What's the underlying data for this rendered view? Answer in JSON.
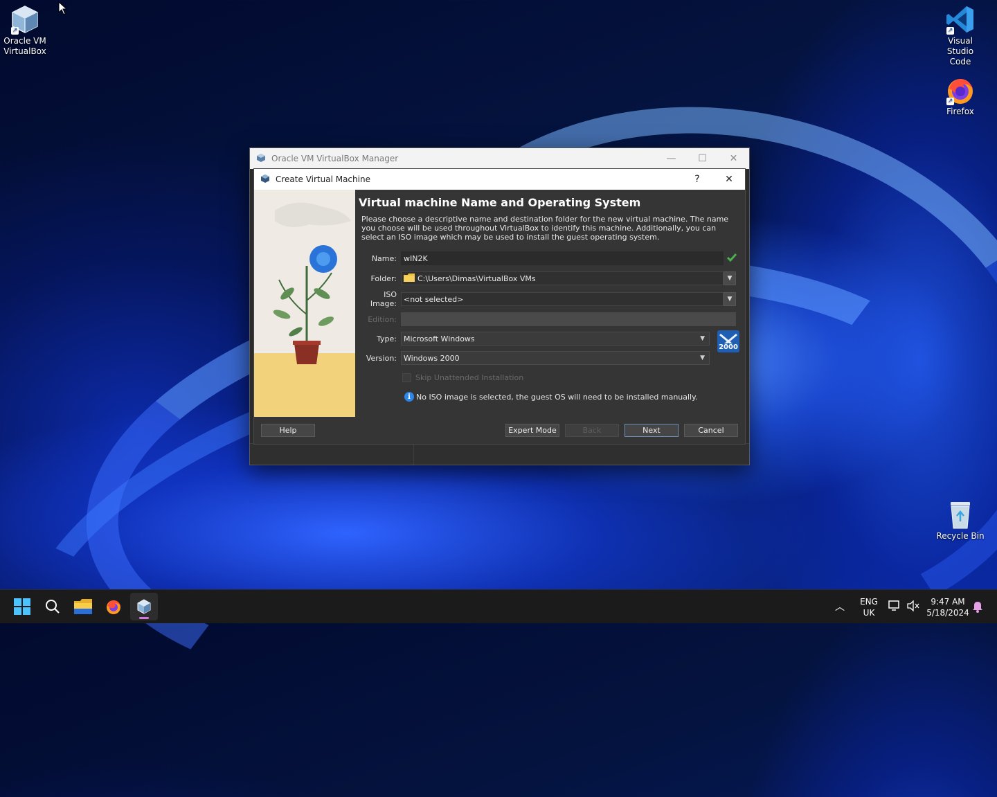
{
  "desktop": {
    "icons": [
      {
        "label_line1": "Oracle VM",
        "label_line2": "VirtualBox"
      },
      {
        "label_line1": "Visual Studio",
        "label_line2": "Code"
      },
      {
        "label_line1": "Firefox",
        "label_line2": ""
      },
      {
        "label_line1": "Recycle Bin",
        "label_line2": ""
      }
    ]
  },
  "manager": {
    "title": "Oracle VM VirtualBox Manager",
    "controls": {
      "minimize": "—",
      "maximize": "☐",
      "close": "✕"
    }
  },
  "dialog": {
    "title": "Create Virtual Machine",
    "help_glyph": "?",
    "close_glyph": "✕",
    "heading": "Virtual machine Name and Operating System",
    "description": "Please choose a descriptive name and destination folder for the new virtual machine. The name you choose will be used throughout VirtualBox to identify this machine. Additionally, you can select an ISO image which may be used to install the guest operating system.",
    "fields": {
      "name": {
        "label": "Name:",
        "value": "wIN2K"
      },
      "folder": {
        "label": "Folder:",
        "value": "C:\\Users\\Dimas\\VirtualBox VMs"
      },
      "iso": {
        "label": "ISO Image:",
        "value": "<not selected>"
      },
      "edition": {
        "label": "Edition:",
        "value": ""
      },
      "type": {
        "label": "Type:",
        "value": "Microsoft Windows"
      },
      "version": {
        "label": "Version:",
        "value": "Windows 2000"
      }
    },
    "os_badge": "2000",
    "unattended_label": "Skip Unattended Installation",
    "info_text": "No ISO image is selected, the guest OS will need to be installed manually.",
    "buttons": {
      "help": "Help",
      "expert": "Expert Mode",
      "back": "Back",
      "next": "Next",
      "cancel": "Cancel"
    }
  },
  "taskbar": {
    "lang_line1": "ENG",
    "lang_line2": "UK",
    "time": "9:47 AM",
    "date": "5/18/2024"
  },
  "colors": {
    "accent_blue": "#2e87e8",
    "valid_check": "#4caf50",
    "taskbar_indicator": "#d07bd9"
  }
}
